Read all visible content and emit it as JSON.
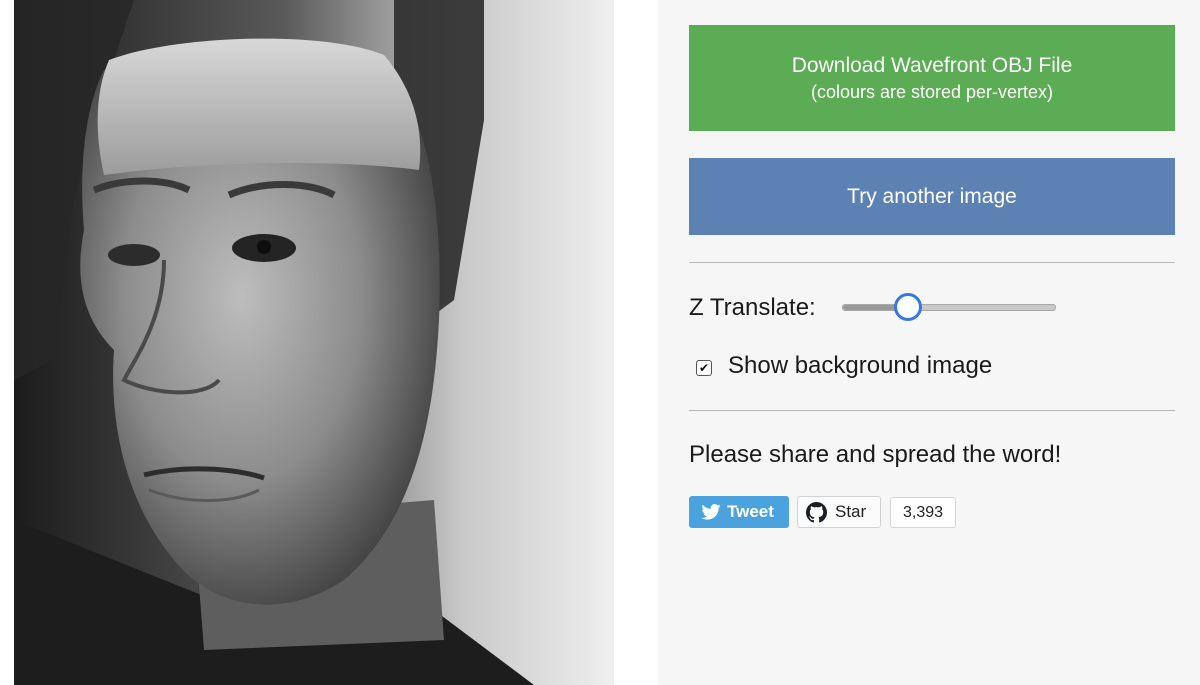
{
  "viewer": {
    "image_description_icon": "portrait-photo"
  },
  "actions": {
    "download_line1": "Download Wavefront OBJ File",
    "download_line2": "(colours are stored per-vertex)",
    "download_color": "#5cab55",
    "try_another": "Try another image",
    "try_color": "#5b82b3"
  },
  "controls": {
    "z_translate_label": "Z Translate:",
    "z_translate_value_percent": 30,
    "show_background_label": "Show background image",
    "show_background_checked": true,
    "accent_color": "#3578e5"
  },
  "share": {
    "text": "Please share and spread the word!",
    "tweet_label": "Tweet",
    "tweet_color": "#4aa3df",
    "star_label": "Star",
    "star_count": "3,393"
  }
}
